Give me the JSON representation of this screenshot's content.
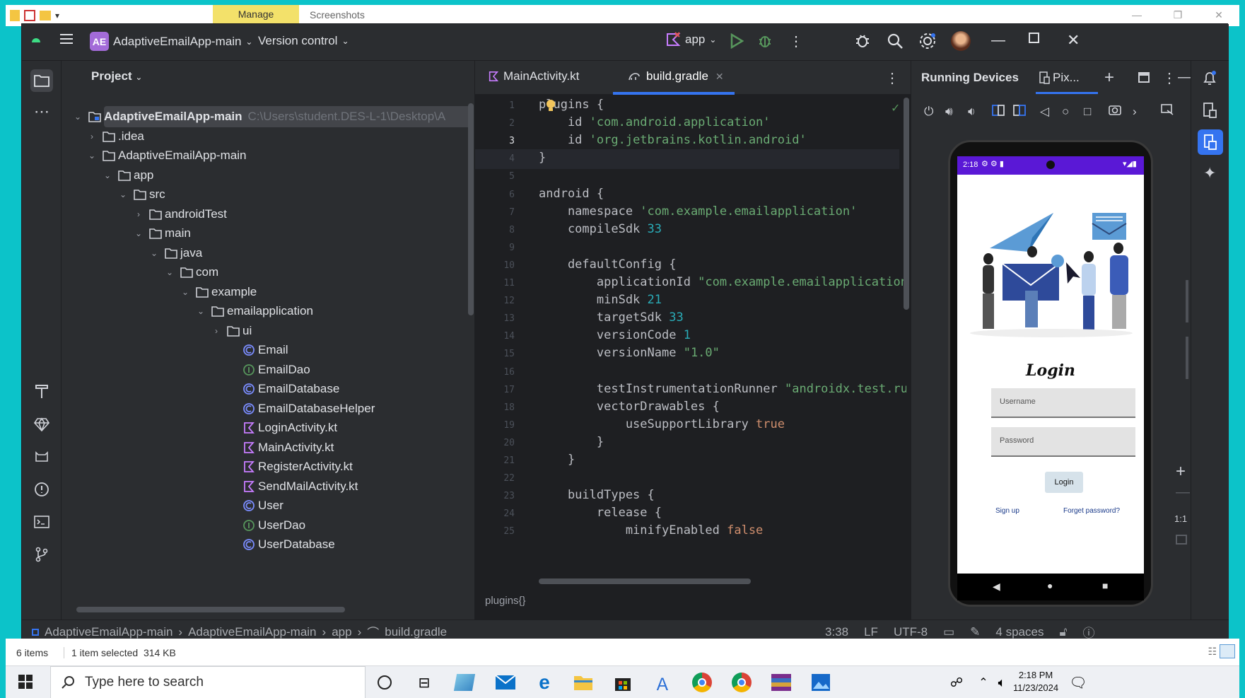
{
  "explorer": {
    "ribbon_tab_manage": "Manage",
    "ribbon_tab_context": "Screenshots",
    "status_items": "6 items",
    "status_selected": "1 item selected  314 KB"
  },
  "toolbar": {
    "project_initials": "AE",
    "project_name": "AdaptiveEmailApp-main",
    "vcs_label": "Version control",
    "run_config": "app"
  },
  "project_panel": {
    "title": "Project",
    "tree": [
      {
        "label": "AdaptiveEmailApp-main",
        "path": "C:\\Users\\student.DES-L-1\\Desktop\\A"
      },
      {
        "label": ".idea"
      },
      {
        "label": "AdaptiveEmailApp-main"
      },
      {
        "label": "app"
      },
      {
        "label": "src"
      },
      {
        "label": "androidTest"
      },
      {
        "label": "main"
      },
      {
        "label": "java"
      },
      {
        "label": "com"
      },
      {
        "label": "example"
      },
      {
        "label": "emailapplication"
      },
      {
        "label": "ui"
      },
      {
        "label": "Email"
      },
      {
        "label": "EmailDao"
      },
      {
        "label": "EmailDatabase"
      },
      {
        "label": "EmailDatabaseHelper"
      },
      {
        "label": "LoginActivity.kt"
      },
      {
        "label": "MainActivity.kt"
      },
      {
        "label": "RegisterActivity.kt"
      },
      {
        "label": "SendMailActivity.kt"
      },
      {
        "label": "User"
      },
      {
        "label": "UserDao"
      },
      {
        "label": "UserDatabase"
      }
    ]
  },
  "editor": {
    "tabs": [
      {
        "label": "MainActivity.kt"
      },
      {
        "label": "build.gradle"
      }
    ],
    "breadcrumb": "plugins{}",
    "lines": [
      {
        "n": "1",
        "code": "plugins {"
      },
      {
        "n": "2",
        "code": "    id 'com.android.application'"
      },
      {
        "n": "3",
        "code": "    id 'org.jetbrains.kotlin.android'"
      },
      {
        "n": "4",
        "code": "}"
      },
      {
        "n": "5",
        "code": ""
      },
      {
        "n": "6",
        "code": "android {"
      },
      {
        "n": "7",
        "code": "    namespace 'com.example.emailapplication'"
      },
      {
        "n": "8",
        "code": "    compileSdk 33"
      },
      {
        "n": "9",
        "code": ""
      },
      {
        "n": "10",
        "code": "    defaultConfig {"
      },
      {
        "n": "11",
        "code": "        applicationId \"com.example.emailapplication"
      },
      {
        "n": "12",
        "code": "        minSdk 21"
      },
      {
        "n": "13",
        "code": "        targetSdk 33"
      },
      {
        "n": "14",
        "code": "        versionCode 1"
      },
      {
        "n": "15",
        "code": "        versionName \"1.0\""
      },
      {
        "n": "16",
        "code": ""
      },
      {
        "n": "17",
        "code": "        testInstrumentationRunner \"androidx.test.ru"
      },
      {
        "n": "18",
        "code": "        vectorDrawables {"
      },
      {
        "n": "19",
        "code": "            useSupportLibrary true"
      },
      {
        "n": "20",
        "code": "        }"
      },
      {
        "n": "21",
        "code": "    }"
      },
      {
        "n": "22",
        "code": ""
      },
      {
        "n": "23",
        "code": "    buildTypes {"
      },
      {
        "n": "24",
        "code": "        release {"
      },
      {
        "n": "25",
        "code": "            minifyEnabled false"
      }
    ]
  },
  "devices": {
    "title": "Running Devices",
    "device_tab": "Pix...",
    "zoom_label": "1:1",
    "phone": {
      "time": "2:18",
      "heading": "Login",
      "username_placeholder": "Username",
      "password_placeholder": "Password",
      "login_button": "Login",
      "signup_link": "Sign up",
      "forgot_link": "Forget password?"
    }
  },
  "status_bar": {
    "crumbs": [
      "AdaptiveEmailApp-main",
      "AdaptiveEmailApp-main",
      "app",
      "build.gradle"
    ],
    "position": "3:38",
    "line_sep": "LF",
    "encoding": "UTF-8",
    "indent": "4 spaces"
  },
  "taskbar": {
    "search_placeholder": "Type here to search",
    "time": "2:18 PM",
    "date": "11/23/2024"
  },
  "colors": {
    "ide_bg": "#2b2d30",
    "editor_bg": "#1e1f22",
    "accent": "#3574f0",
    "desktop": "#0cc3c9"
  }
}
